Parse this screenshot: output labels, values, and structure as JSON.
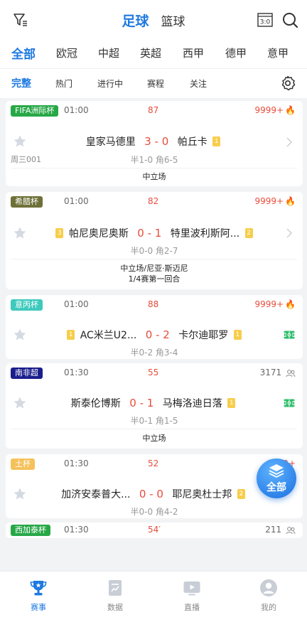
{
  "header": {
    "sport_tabs": [
      "足球",
      "篮球"
    ],
    "score_icon_text": "3:0"
  },
  "league_tabs": [
    "全部",
    "欧冠",
    "中超",
    "英超",
    "西甲",
    "德甲",
    "意甲"
  ],
  "sub_tabs": [
    "完整",
    "热门",
    "进行中",
    "赛程",
    "关注"
  ],
  "matches": [
    {
      "league": "FIFA洲际杯",
      "league_color": "#27a847",
      "time": "01:00",
      "minute": "87",
      "heat": "9999+",
      "home": "皇家马德里",
      "home_rank": "",
      "score_home": "3",
      "score_away": "0",
      "away": "帕丘卡",
      "away_rank": "1",
      "half": "半1-0 角6-5",
      "round": "周三001",
      "venue": [
        "中立场"
      ]
    },
    {
      "league": "希腊杯",
      "league_color": "#6e7038",
      "time": "01:00",
      "minute": "82",
      "heat": "9999+",
      "home": "帕尼奥尼奥斯",
      "home_rank": "3",
      "score_home": "0",
      "score_away": "1",
      "away": "特里波利斯阿...",
      "away_rank": "2",
      "half": "半0-0 角2-7",
      "round": "",
      "venue": [
        "中立场/尼亚·斯迈尼",
        "1/4赛第一回合"
      ]
    },
    {
      "league": "意丙杯",
      "league_color": "#3ec9bd",
      "time": "01:00",
      "minute": "88",
      "heat": "9999+",
      "home": "AC米兰U2...",
      "home_rank": "1",
      "score_home": "0",
      "score_away": "2",
      "away": "卡尔迪耶罗",
      "away_rank": "1",
      "half": "半0-2 角3-4",
      "round": "",
      "venue": []
    },
    {
      "league": "南非超",
      "league_color": "#1a1e8c",
      "time": "01:30",
      "minute": "55",
      "heat": "3171",
      "home": "斯泰伦博斯",
      "home_rank": "",
      "score_home": "0",
      "score_away": "1",
      "away": "马梅洛迪日落",
      "away_rank": "1",
      "half": "半0-1 角1-5",
      "round": "",
      "venue": [
        "中立场"
      ]
    },
    {
      "league": "土杯",
      "league_color": "#f5c15a",
      "time": "01:30",
      "minute": "52",
      "heat": "9999+",
      "home": "加济安泰普大...",
      "home_rank": "",
      "score_home": "0",
      "score_away": "0",
      "away": "耶尼奥杜士邦",
      "away_rank": "2",
      "half": "半0-0 角4-2",
      "round": "",
      "venue": []
    },
    {
      "league": "西加泰杯",
      "league_color": "#27a847",
      "time": "01:30",
      "minute": "54′",
      "heat": "211",
      "home": "",
      "home_rank": "",
      "score_home": "",
      "score_away": "",
      "away": "",
      "away_rank": "",
      "half": "",
      "round": "",
      "venue": []
    }
  ],
  "float_button": {
    "label": "全部"
  },
  "bottom_nav": [
    "赛事",
    "数据",
    "直播",
    "我的"
  ],
  "colors": {
    "accent": "#1f7ae0",
    "score": "#e74c3c",
    "rank_badge": "#f7cd4a"
  }
}
